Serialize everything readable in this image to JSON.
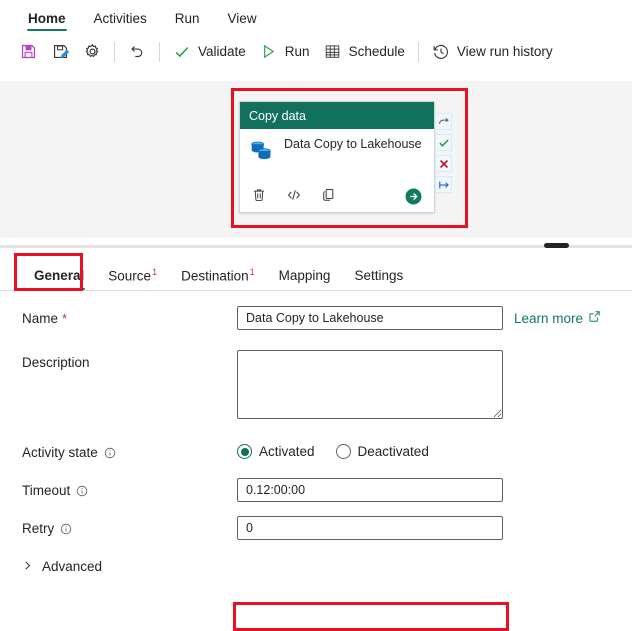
{
  "ribbon": {
    "tabs": [
      {
        "label": "Home",
        "active": true
      },
      {
        "label": "Activities",
        "active": false
      },
      {
        "label": "Run",
        "active": false
      },
      {
        "label": "View",
        "active": false
      }
    ]
  },
  "toolbar": {
    "items": [
      {
        "label": "",
        "icon": "save-icon",
        "name": "save-button"
      },
      {
        "label": "",
        "icon": "save-as-icon",
        "name": "save-as-button"
      },
      {
        "label": "",
        "icon": "gear-icon",
        "name": "settings-button"
      },
      {
        "label": "",
        "icon": "undo-icon",
        "name": "undo-button"
      },
      {
        "label": "Validate",
        "icon": "checkmark-icon",
        "name": "validate-button"
      },
      {
        "label": "Run",
        "icon": "play-icon",
        "name": "run-button"
      },
      {
        "label": "Schedule",
        "icon": "calendar-icon",
        "name": "schedule-button"
      },
      {
        "label": "View run history",
        "icon": "history-icon",
        "name": "view-run-history-button"
      }
    ],
    "validate_label": "Validate",
    "run_label": "Run",
    "schedule_label": "Schedule",
    "history_label": "View run history"
  },
  "canvas": {
    "activity": {
      "header": "Copy data",
      "title": "Data Copy to Lakehouse",
      "icon": "copy-data-database-icon",
      "actions": [
        {
          "name": "delete-activity-button",
          "icon": "trash-icon"
        },
        {
          "name": "view-code-button",
          "icon": "code-icon"
        },
        {
          "name": "duplicate-activity-button",
          "icon": "copy-icon"
        }
      ],
      "go_button": "add-next-activity-button"
    },
    "connectors": [
      {
        "name": "on-completion-connector",
        "icon": "skip-arrow-icon"
      },
      {
        "name": "on-success-connector",
        "icon": "checkmark-icon"
      },
      {
        "name": "on-failure-connector",
        "icon": "x-icon"
      },
      {
        "name": "on-skip-connector",
        "icon": "arrow-right-icon"
      }
    ]
  },
  "properties": {
    "tabs": [
      {
        "label": "General",
        "badge": "",
        "active": true
      },
      {
        "label": "Source",
        "badge": "1",
        "active": false
      },
      {
        "label": "Destination",
        "badge": "1",
        "active": false
      },
      {
        "label": "Mapping",
        "badge": "",
        "active": false
      },
      {
        "label": "Settings",
        "badge": "",
        "active": false
      }
    ],
    "general": {
      "name_label": "Name",
      "name_required": "*",
      "name_value": "Data Copy to Lakehouse",
      "name_placeholder": "",
      "learn_more": "Learn more",
      "description_label": "Description",
      "description_value": "",
      "description_placeholder": "",
      "activity_state_label": "Activity state",
      "activated_label": "Activated",
      "deactivated_label": "Deactivated",
      "activity_state_value": "Activated",
      "timeout_label": "Timeout",
      "timeout_value": "0.12:00:00",
      "retry_label": "Retry",
      "retry_value": "0",
      "advanced_label": "Advanced"
    }
  },
  "colors": {
    "accent_teal": "#107c62",
    "card_header": "#11715c",
    "highlight_red": "#e81123",
    "required_red": "#c4314b",
    "save_purple": "#b146c2",
    "db_blue": "#0f6cbd",
    "green": "#2aa44f"
  }
}
